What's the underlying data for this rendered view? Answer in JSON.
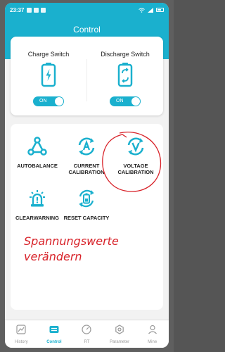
{
  "status_bar": {
    "time": "23:37"
  },
  "header": {
    "title": "Control"
  },
  "switches": [
    {
      "label": "Charge Switch",
      "state": "ON",
      "icon": "charge-icon"
    },
    {
      "label": "Discharge Switch",
      "state": "ON",
      "icon": "discharge-icon"
    }
  ],
  "functions": [
    {
      "label": "AUTOBALANCE",
      "icon": "triangle-network-icon"
    },
    {
      "label": "CURRENT\nCALIBRATION",
      "icon": "current-calibration-icon"
    },
    {
      "label": "VOLTAGE\nCALIBRATION",
      "icon": "voltage-calibration-icon"
    },
    {
      "label": "CLEARWARNING",
      "icon": "alarm-icon"
    },
    {
      "label": "RESET CAPACITY",
      "icon": "battery-reset-icon"
    }
  ],
  "annotation": {
    "line1": "Spannungswerte",
    "line2": "verändern",
    "color": "#d8232a"
  },
  "nav": [
    {
      "label": "History",
      "active": false
    },
    {
      "label": "Control",
      "active": true
    },
    {
      "label": "RT",
      "active": false
    },
    {
      "label": "Parameter",
      "active": false
    },
    {
      "label": "Mine",
      "active": false
    }
  ],
  "colors": {
    "accent": "#1ab0ce"
  }
}
